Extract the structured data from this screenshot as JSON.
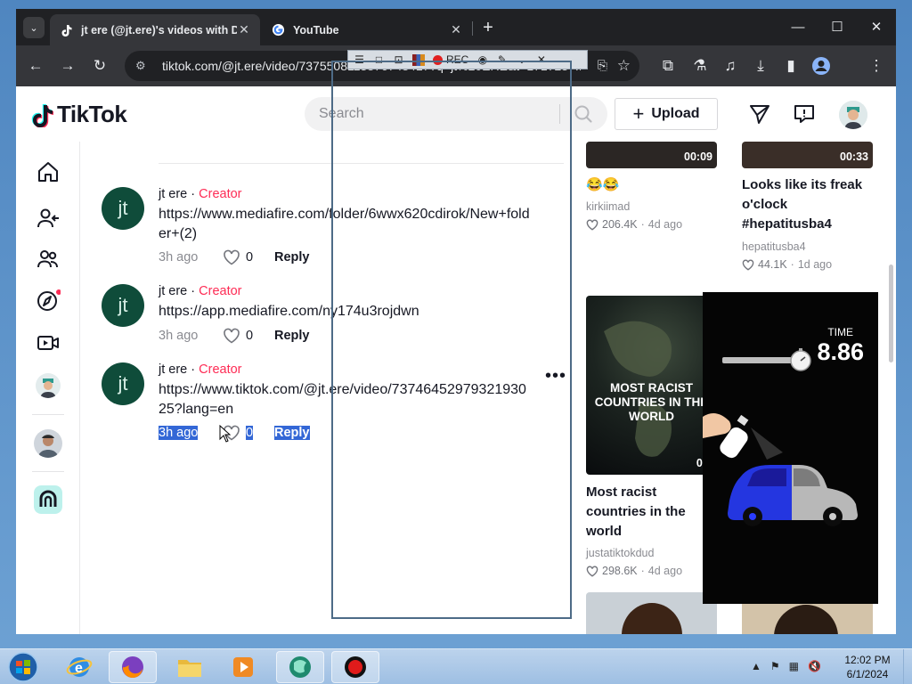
{
  "browser": {
    "tabs": [
      {
        "title": "jt ere (@jt.ere)'s videos with D",
        "active": true
      },
      {
        "title": "YouTube",
        "active": false
      }
    ],
    "address": "tiktok.com/@jt.ere/video/7375508113876748417?q=jt%20ERE&t=1717237..."
  },
  "recorder": {
    "rec_label": "REC"
  },
  "header": {
    "logo_text": "TikTok",
    "search_placeholder": "Search",
    "upload_label": "Upload"
  },
  "comments": [
    {
      "avatar": "jt",
      "user": "jt ere",
      "sep": " · ",
      "badge": "Creator",
      "text": "https://www.mediafire.com/folder/6wwx620cdirok/New+folder+(2)",
      "time": "3h ago",
      "likes": "0",
      "reply": "Reply",
      "selected": false
    },
    {
      "avatar": "jt",
      "user": "jt ere",
      "sep": " · ",
      "badge": "Creator",
      "text": "https://app.mediafire.com/ny174u3rojdwn",
      "time": "3h ago",
      "likes": "0",
      "reply": "Reply",
      "selected": false
    },
    {
      "avatar": "jt",
      "user": "jt ere",
      "sep": " · ",
      "badge": "Creator",
      "text": "https://www.tiktok.com/@jt.ere/video/7374645297932193025?lang=en",
      "time": "3h ago",
      "likes": "0",
      "reply": "Reply",
      "selected": true
    }
  ],
  "videos": [
    {
      "duration": "00:09",
      "title": "😂😂",
      "author": "kirkiimad",
      "likes": "206.4K",
      "age": "4d ago"
    },
    {
      "duration": "00:33",
      "title": "Looks like its freak o'clock #hepatitusba4",
      "author": "hepatitusba4",
      "likes": "44.1K",
      "age": "1d ago"
    },
    {
      "duration": "00:",
      "title": "Most racist countries in the world",
      "author": "justatiktokdud",
      "likes": "298.6K",
      "age": "4d ago",
      "overlay": "MOST RACIST COUNTRIES IN THE WORLD"
    }
  ],
  "game": {
    "time_label": "TIME",
    "time_value": "8.86"
  },
  "taskbar": {
    "time": "12:02 PM",
    "date": "6/1/2024"
  },
  "colors": {
    "creator": "#fe2c55",
    "avatar_bg": "#0f4c3a",
    "selection": "#3367d6"
  }
}
